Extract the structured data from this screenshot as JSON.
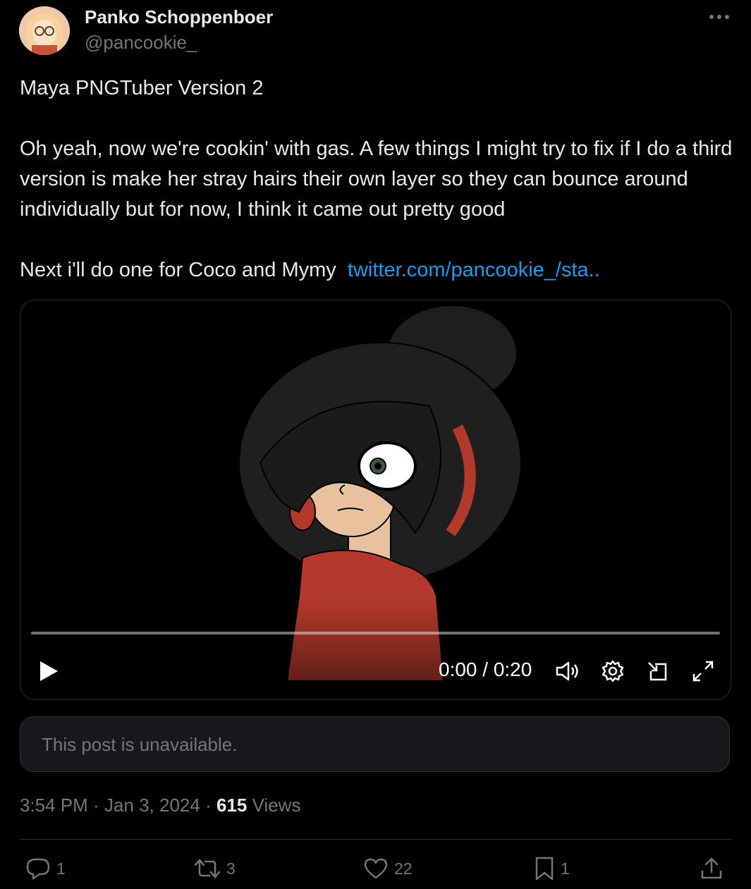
{
  "author": {
    "display_name": "Panko Schoppenboer",
    "handle": "@pancookie_"
  },
  "menu_icon": "more-dots-icon",
  "tweet": {
    "title": "Maya PNGTuber Version 2",
    "paragraph_1": "Oh yeah, now we're cookin' with gas. A few things I might try to fix if I do a third version is make her stray hairs their own layer so they can bounce around individually but for now, I think it came out pretty good",
    "paragraph_2": "Next i'll do one for Coco and Mymy",
    "link_text": "twitter.com/pancookie_/sta.."
  },
  "video": {
    "time": "0:00 / 0:20",
    "progress": 0,
    "icons": [
      "play-icon",
      "volume-icon",
      "settings-icon",
      "pip-icon",
      "fullscreen-icon"
    ]
  },
  "quoted_post": {
    "text": "This post is unavailable."
  },
  "meta": {
    "time": "3:54 PM",
    "date": "Jan 3, 2024",
    "views_count": "615",
    "views_label": "Views"
  },
  "actions": {
    "replies": "1",
    "reposts": "3",
    "likes": "22",
    "bookmarks": "1"
  },
  "colors": {
    "background": "#000000",
    "text": "#e7e9ea",
    "secondary": "#71767b",
    "link": "#1d9bf0",
    "border": "#2f3336"
  }
}
